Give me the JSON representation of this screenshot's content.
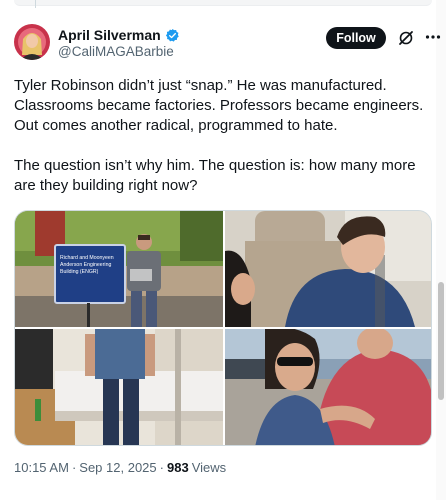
{
  "author": {
    "display_name": "April Silverman",
    "handle": "@CaliMAGABarbie",
    "verified": true
  },
  "actions": {
    "follow_label": "Follow"
  },
  "tweet": {
    "paragraphs": [
      "Tyler Robinson didn’t just “snap.” He was manufactured. Classrooms became factories. Professors became engineers. Out comes another radical, programmed to hate.",
      "The question isn’t why him. The question is: how many more are they building right now?"
    ]
  },
  "media": {
    "photo1_sign": {
      "line1": "Richard and Moonyeen",
      "line2": "Anderson Engineering",
      "line3": "Building (ENGR)"
    }
  },
  "meta": {
    "time": "10:15 AM",
    "separator": "·",
    "date": "Sep 12, 2025",
    "views_count": "983",
    "views_label": "Views"
  },
  "colors": {
    "verified_badge": "#1d9bf0",
    "follow_button_bg": "#0f1419",
    "secondary_text": "#536471"
  }
}
